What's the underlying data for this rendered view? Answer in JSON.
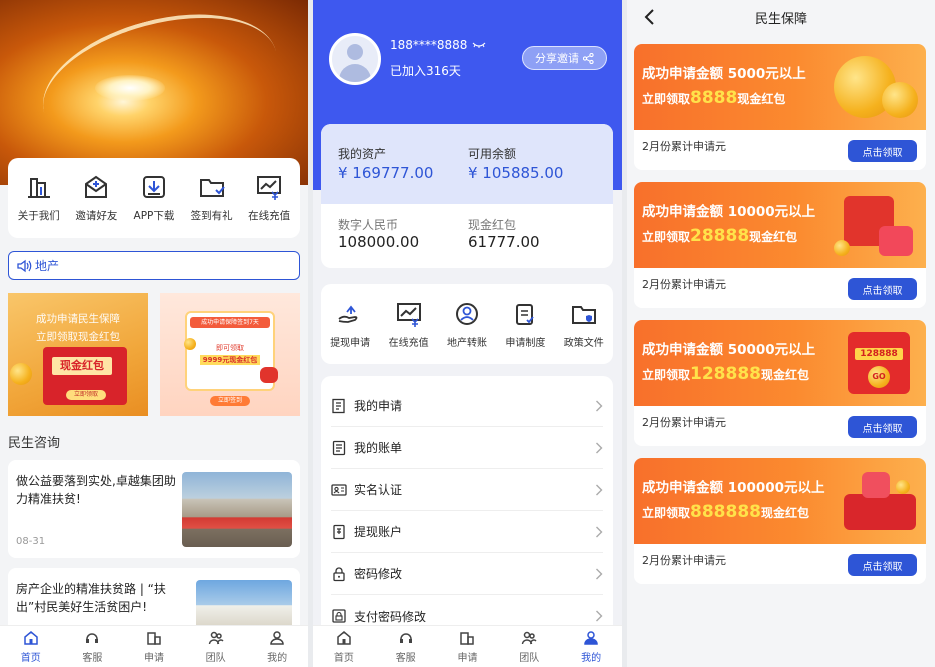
{
  "home": {
    "quick_links": [
      {
        "label": "关于我们",
        "icon": "building-icon"
      },
      {
        "label": "邀请好友",
        "icon": "mail-invite-icon"
      },
      {
        "label": "APP下载",
        "icon": "download-icon"
      },
      {
        "label": "签到有礼",
        "icon": "folder-check-icon"
      },
      {
        "label": "在线充值",
        "icon": "chart-currency-icon"
      }
    ],
    "notice": "地产",
    "promo_left": {
      "line1": "成功申请民生保障",
      "line2": "立即领取现金红包",
      "envelope": "现金红包",
      "button": "立即领取"
    },
    "promo_right": {
      "bar": "成功申请保障签到7天",
      "line1": "即可领取",
      "line2": "9999元现金红包",
      "button": "立即签到"
    },
    "section_title": "民生咨询",
    "news": [
      {
        "title": "做公益要落到实处,卓越集团助力精准扶贫!",
        "date": "08-31"
      },
      {
        "title": "房产企业的精准扶贫路 | “扶出”村民美好生活贫困户!",
        "date": ""
      }
    ],
    "tabs": [
      {
        "label": "首页",
        "active": true
      },
      {
        "label": "客服",
        "active": false
      },
      {
        "label": "申请",
        "active": false
      },
      {
        "label": "团队",
        "active": false
      },
      {
        "label": "我的",
        "active": false
      }
    ]
  },
  "profile": {
    "phone": "188****8888",
    "joined": "已加入316天",
    "share": "分享邀请",
    "assets": {
      "total_label": "我的资产",
      "total_value": "¥ 169777.00",
      "available_label": "可用余额",
      "available_value": "¥ 105885.00",
      "digital_label": "数字人民币",
      "digital_value": "108000.00",
      "cash_label": "现金红包",
      "cash_value": "61777.00"
    },
    "actions": [
      {
        "label": "提现申请",
        "icon": "hand-money-icon"
      },
      {
        "label": "在线充值",
        "icon": "chart-currency-icon"
      },
      {
        "label": "地产转账",
        "icon": "user-circle-icon"
      },
      {
        "label": "申请制度",
        "icon": "clipboard-check-icon"
      },
      {
        "label": "政策文件",
        "icon": "folder-shield-icon"
      }
    ],
    "menu": [
      {
        "label": "我的申请",
        "icon": "application-icon"
      },
      {
        "label": "我的账单",
        "icon": "bill-icon"
      },
      {
        "label": "实名认证",
        "icon": "id-card-icon"
      },
      {
        "label": "提现账户",
        "icon": "account-icon"
      },
      {
        "label": "密码修改",
        "icon": "lock-icon"
      },
      {
        "label": "支付密码修改",
        "icon": "payment-lock-icon"
      }
    ],
    "tabs": [
      {
        "label": "首页",
        "active": false
      },
      {
        "label": "客服",
        "active": false
      },
      {
        "label": "申请",
        "active": false
      },
      {
        "label": "团队",
        "active": false
      },
      {
        "label": "我的",
        "active": true
      }
    ]
  },
  "welfare": {
    "title": "民生保障",
    "cards": [
      {
        "line1": "成功申请金额 5000元以上",
        "pre": "立即领取",
        "amount": "8888",
        "post": "现金红包",
        "foot": "2月份累计申请元",
        "button": "点击领取"
      },
      {
        "line1": "成功申请金额 10000元以上",
        "pre": "立即领取",
        "amount": "28888",
        "post": "现金红包",
        "foot": "2月份累计申请元",
        "button": "点击领取"
      },
      {
        "line1": "成功申请金额 50000元以上",
        "pre": "立即领取",
        "amount": "128888",
        "post": "现金红包",
        "foot": "2月份累计申请元",
        "button": "点击领取",
        "badge": "128888",
        "badge2": "GO"
      },
      {
        "line1": "成功申请金额 100000元以上",
        "pre": "立即领取",
        "amount": "888888",
        "post": "现金红包",
        "foot": "2月份累计申请元",
        "button": "点击领取"
      }
    ]
  },
  "colors": {
    "accent": "#2e55d6",
    "header_blue": "#3e58ef",
    "banner_orange": "#f8702b",
    "highlight_yellow": "#ffe24a"
  }
}
